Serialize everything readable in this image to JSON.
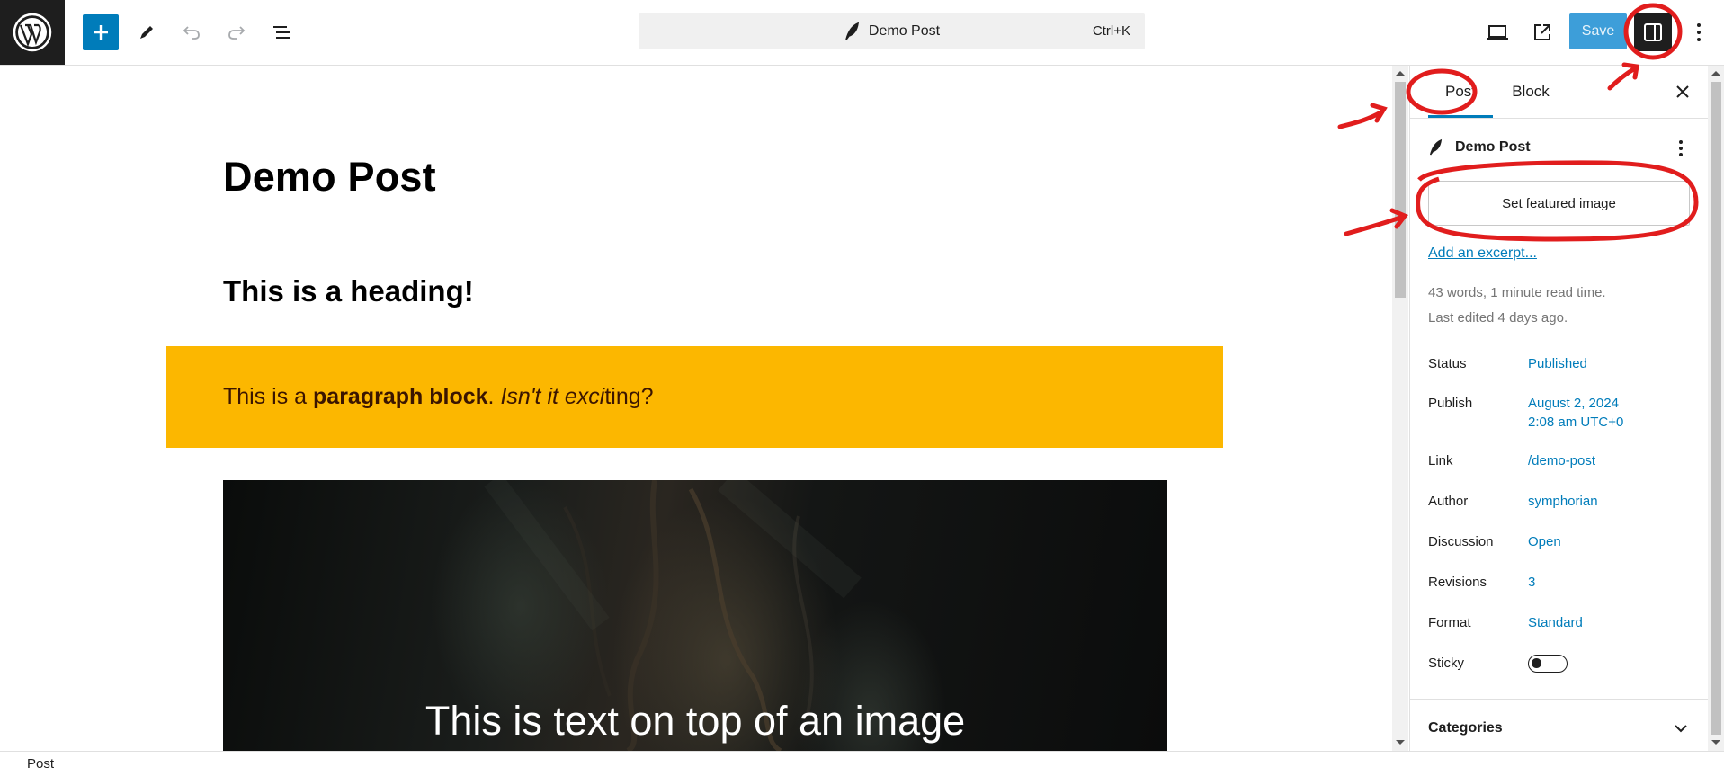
{
  "colors": {
    "accent": "#007cba",
    "save_bg": "#3d9ed9",
    "paragraph_bg": "#fcb700",
    "annotation": "#e11d1d"
  },
  "toolbar": {
    "logo_icon": "wordpress-logo",
    "add_icon": "plus-icon",
    "tools_icon": "pencil-icon",
    "undo_icon": "undo-icon",
    "redo_icon": "redo-icon",
    "outline_icon": "document-overview-icon",
    "command_bar": {
      "icon": "feather-icon",
      "title": "Demo Post",
      "shortcut": "Ctrl+K"
    },
    "view_icon": "laptop-icon",
    "preview_icon": "external-link-icon",
    "save_label": "Save",
    "settings_icon": "sidebar-toggle-icon",
    "options_icon": "more-vertical-icon"
  },
  "editor": {
    "post_title": "Demo Post",
    "heading": "This is a heading!",
    "paragraph": {
      "prefix": "This is a ",
      "bold": "paragraph block",
      "mid": ". ",
      "italic": "Isn't it exci",
      "suffix": "ting?"
    },
    "cover_text": "This is text on top of an image"
  },
  "sidebar": {
    "tabs": [
      {
        "label": "Post",
        "active": true
      },
      {
        "label": "Block",
        "active": false
      }
    ],
    "close_icon": "close-icon",
    "post_card": {
      "icon": "feather-icon",
      "title": "Demo Post",
      "menu_icon": "more-vertical-icon"
    },
    "featured_image_label": "Set featured image",
    "excerpt_link": "Add an excerpt...",
    "word_count": "43 words, 1 minute read time.",
    "last_edited": "Last edited 4 days ago.",
    "rows": [
      {
        "label": "Status",
        "value": "Published"
      },
      {
        "label": "Publish",
        "value": "August 2, 2024",
        "value2": "2:08 am UTC+0"
      },
      {
        "label": "Link",
        "value": "/demo-post"
      },
      {
        "label": "Author",
        "value": "symphorian"
      },
      {
        "label": "Discussion",
        "value": "Open"
      },
      {
        "label": "Revisions",
        "value": "3"
      },
      {
        "label": "Format",
        "value": "Standard"
      },
      {
        "label": "Sticky",
        "toggle_on": false
      }
    ],
    "categories_label": "Categories",
    "categories_icon": "chevron-down-icon"
  },
  "footer": {
    "breadcrumb": "Post"
  }
}
